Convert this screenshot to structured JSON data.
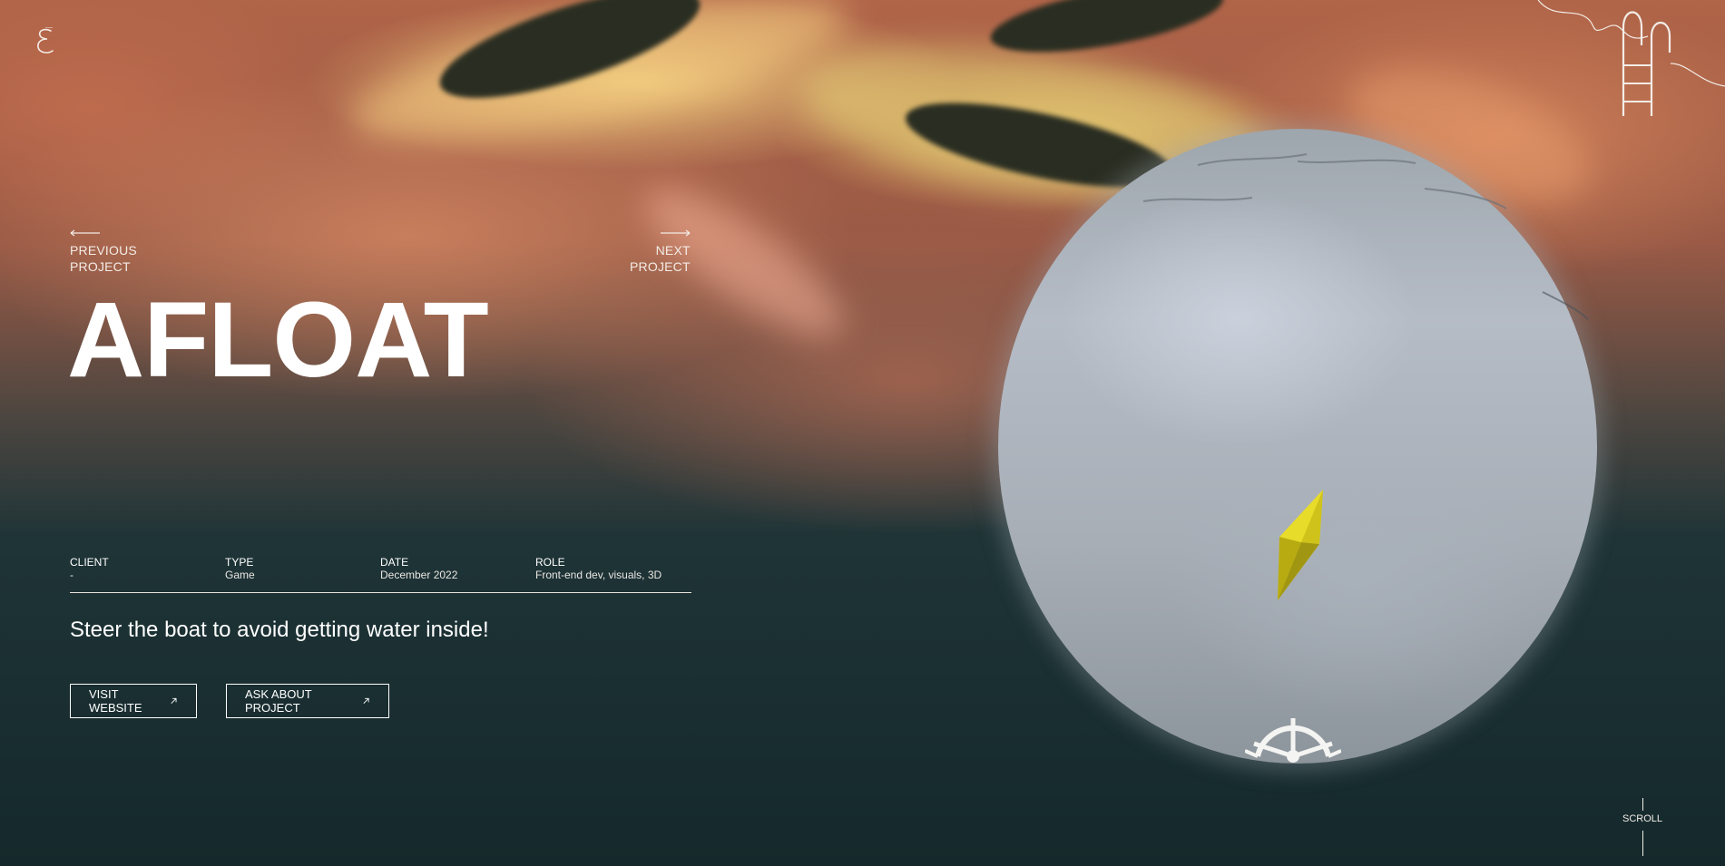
{
  "header": {
    "logo_icon": "script-e-logo-icon",
    "corner_icon": "pool-ladder-icon"
  },
  "nav": {
    "previous_line1": "PREVIOUS",
    "previous_line2": "PROJECT",
    "next_line1": "NEXT",
    "next_line2": "PROJECT"
  },
  "project": {
    "title": "AFLOAT",
    "tagline": "Steer the boat to avoid getting water inside!"
  },
  "meta": {
    "client_label": "CLIENT",
    "client_value": "-",
    "type_label": "TYPE",
    "type_value": "Game",
    "date_label": "DATE",
    "date_value": "December 2022",
    "role_label": "ROLE",
    "role_value": "Front-end dev, visuals, 3D"
  },
  "actions": {
    "visit_label": "VISIT WEBSITE",
    "ask_label": "ASK ABOUT PROJECT"
  },
  "scroll": {
    "label": "SCROLL"
  },
  "colors": {
    "text": "#ffffff",
    "sea_dark": "#15292c",
    "sky_warm": "#b06448",
    "crystal": "#e8dc2a"
  }
}
